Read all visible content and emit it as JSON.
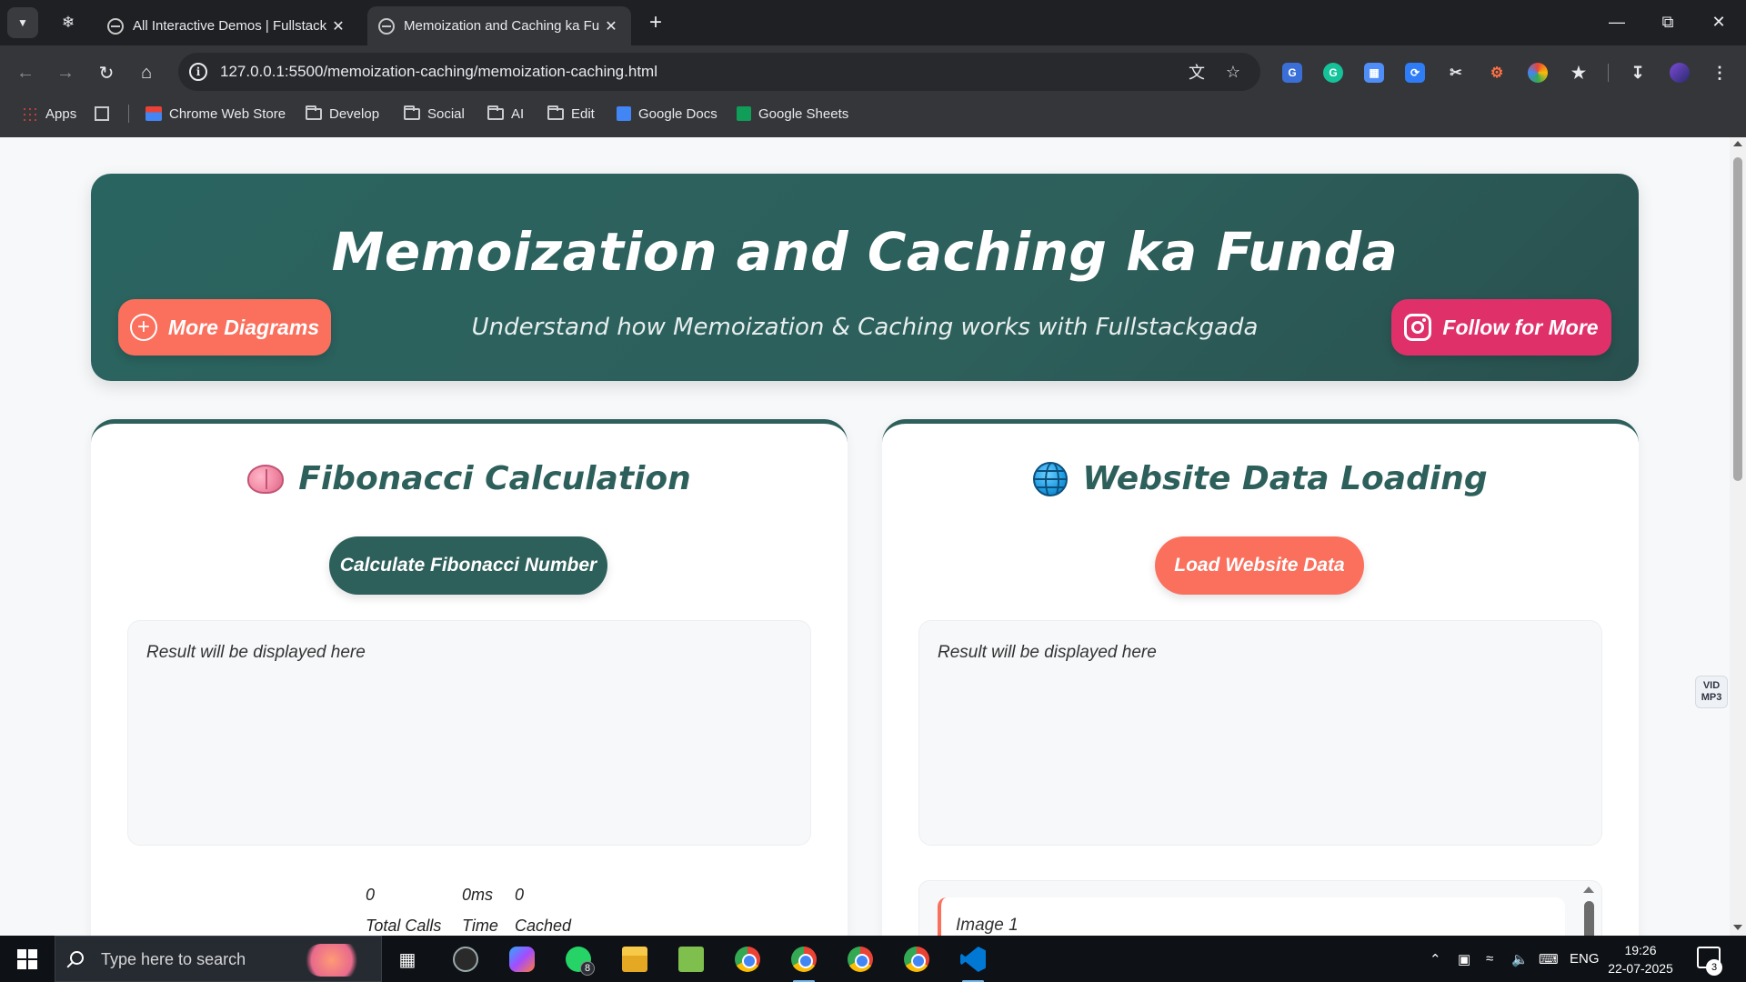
{
  "browser": {
    "tabs": [
      {
        "title": "All Interactive Demos | Fullstack"
      },
      {
        "title": "Memoization and Caching ka Fu"
      }
    ],
    "url": "127.0.0.1:5500/memoization-caching/memoization-caching.html",
    "bookmarks": [
      {
        "label": "Apps",
        "icon": "apps-grid-icon"
      },
      {
        "label": "Chrome Web Store",
        "icon": "chrome-web-store-icon"
      },
      {
        "label": "Develop",
        "icon": "folder-icon"
      },
      {
        "label": "Social",
        "icon": "folder-icon"
      },
      {
        "label": "AI",
        "icon": "folder-icon"
      },
      {
        "label": "Edit",
        "icon": "folder-icon"
      },
      {
        "label": "Google Docs",
        "icon": "google-docs-icon"
      },
      {
        "label": "Google Sheets",
        "icon": "google-sheets-icon"
      }
    ]
  },
  "hero": {
    "title": "Memoization and Caching ka Funda",
    "subtitle": "Understand how Memoization & Caching works with Fullstackgada",
    "more_button": "More Diagrams",
    "follow_button": "Follow for More"
  },
  "fibonacci": {
    "title": "Fibonacci Calculation",
    "button": "Calculate Fibonacci Number",
    "result": "Result will be displayed here",
    "stats": [
      {
        "value": "0",
        "label": "Total Calls"
      },
      {
        "value": "0ms",
        "label": "Time"
      },
      {
        "value": "0",
        "label": "Cached"
      }
    ]
  },
  "website": {
    "title": "Website Data Loading",
    "button": "Load Website Data",
    "result": "Result will be displayed here",
    "images": [
      {
        "label": "Image 1"
      }
    ]
  },
  "side_widget": {
    "line1": "VID",
    "line2": "MP3"
  },
  "taskbar": {
    "search_placeholder": "Type here to search",
    "whatsapp_badge": "8",
    "language": "ENG",
    "time": "19:26",
    "date": "22-07-2025",
    "notifications": "3"
  },
  "colors": {
    "primary": "#2d5f5b",
    "accent": "#fb6f5d",
    "instagram": "#e0306a"
  }
}
